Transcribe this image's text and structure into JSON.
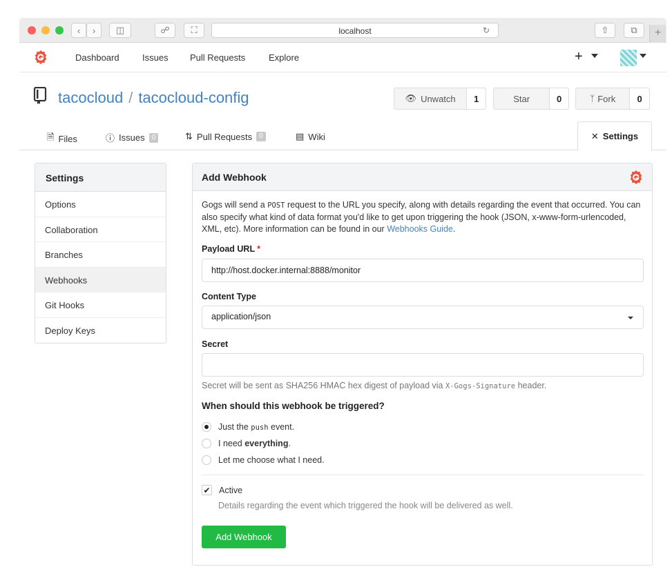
{
  "browser": {
    "url": "localhost"
  },
  "nav": {
    "links": [
      "Dashboard",
      "Issues",
      "Pull Requests",
      "Explore"
    ],
    "plus": "+"
  },
  "repo": {
    "owner": "tacocloud",
    "separator": "/",
    "name": "tacocloud-config",
    "watch": {
      "label": "Unwatch",
      "count": "1"
    },
    "star": {
      "label": "Star",
      "count": "0"
    },
    "fork": {
      "label": "Fork",
      "count": "0"
    }
  },
  "tabs": {
    "files": "Files",
    "issues": {
      "label": "Issues",
      "count": "0"
    },
    "pulls": {
      "label": "Pull Requests",
      "count": "0"
    },
    "wiki": "Wiki",
    "settings": "Settings"
  },
  "sidebar": {
    "title": "Settings",
    "items": [
      "Options",
      "Collaboration",
      "Branches",
      "Webhooks",
      "Git Hooks",
      "Deploy Keys"
    ],
    "active": "Webhooks"
  },
  "form": {
    "title": "Add Webhook",
    "desc_pre": "Gogs will send a ",
    "desc_code": "POST",
    "desc_mid": " request to the URL you specify, along with details regarding the event that occurred. You can also specify what kind of data format you'd like to get upon triggering the hook (JSON, x-www-form-urlencoded, XML, etc). More information can be found in our ",
    "desc_link": "Webhooks Guide",
    "desc_end": ".",
    "payload_label": "Payload URL",
    "payload_required": "*",
    "payload_value": "http://host.docker.internal:8888/monitor",
    "content_type_label": "Content Type",
    "content_type_value": "application/json",
    "secret_label": "Secret",
    "secret_value": "",
    "secret_help_pre": "Secret will be sent as SHA256 HMAC hex digest of payload via ",
    "secret_help_code": "X-Gogs-Signature",
    "secret_help_post": " header.",
    "trigger_question": "When should this webhook be triggered?",
    "trigger_options": {
      "push_pre": "Just the ",
      "push_code": "push",
      "push_post": " event.",
      "everything_pre": "I need ",
      "everything_bold": "everything",
      "everything_post": ".",
      "choose": "Let me choose what I need."
    },
    "trigger_selected": "push",
    "active_label": "Active",
    "active_checked": true,
    "active_help": "Details regarding the event which triggered the hook will be delivered as well.",
    "submit_label": "Add Webhook"
  },
  "colors": {
    "accent": "#4183c4",
    "success": "#21ba45",
    "logo": "#e8553e"
  }
}
